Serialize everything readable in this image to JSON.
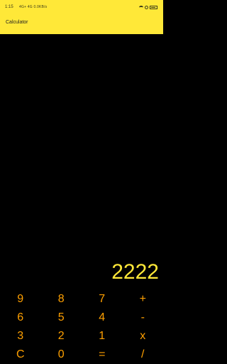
{
  "status_bar": {
    "time": "1:15",
    "network": "4G+ 4G 0.0KB/s",
    "icons": [
      "wifi-icon",
      "mute-icon",
      "battery-icon"
    ]
  },
  "app_bar": {
    "title": "Calculator"
  },
  "display": {
    "value": "2222"
  },
  "keypad": {
    "keys": [
      "9",
      "8",
      "7",
      "+",
      "6",
      "5",
      "4",
      "-",
      "3",
      "2",
      "1",
      "x",
      "C",
      "0",
      "=",
      "/"
    ]
  },
  "colors": {
    "accent": "#FFE838",
    "key_text": "#FFA000",
    "background": "#000000"
  }
}
